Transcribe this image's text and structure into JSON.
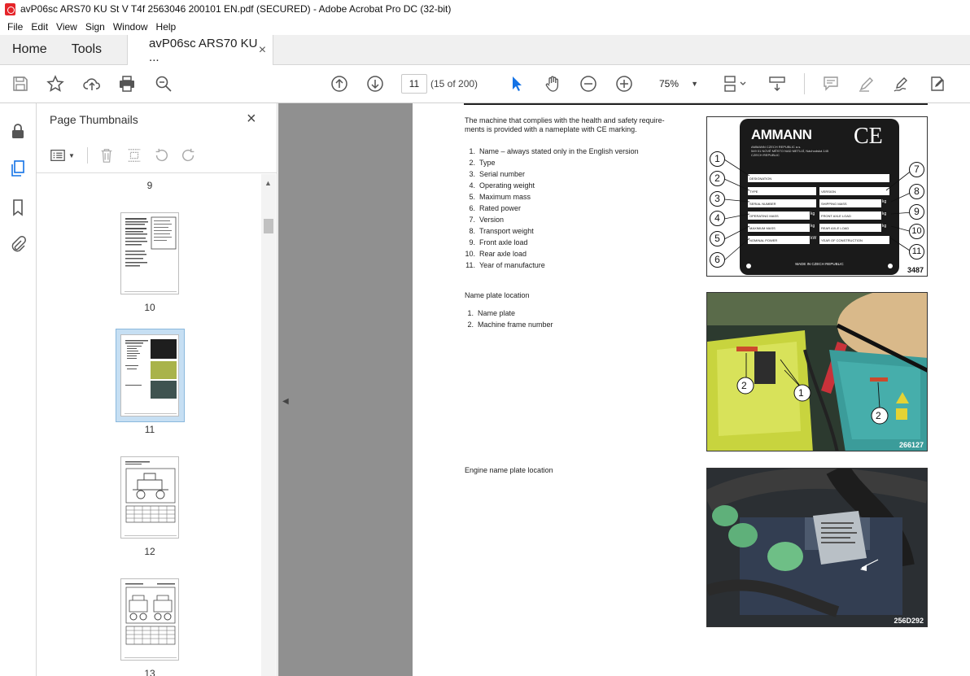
{
  "window": {
    "title": "avP06sc ARS70 KU St V T4f 2563046 200101 EN.pdf (SECURED) - Adobe Acrobat Pro DC (32-bit)"
  },
  "menu": [
    "File",
    "Edit",
    "View",
    "Sign",
    "Window",
    "Help"
  ],
  "tabs": {
    "home": "Home",
    "tools": "Tools",
    "document": "avP06sc ARS70 KU ...",
    "close": "×"
  },
  "toolbar": {
    "page_number": "11",
    "page_of": "(15 of 200)",
    "zoom": "75%"
  },
  "thumbnails": {
    "title": "Page Thumbnails",
    "pages": [
      {
        "label": "9"
      },
      {
        "label": "10"
      },
      {
        "label": "11",
        "selected": true
      },
      {
        "label": "12"
      },
      {
        "label": "13"
      }
    ]
  },
  "document": {
    "intro": "The machine that complies with the health and safety requirements is provided with a nameplate with CE marking.",
    "intro_line1": "The machine that complies with the health and safety require-",
    "intro_line2": "ments is provided with a nameplate with CE marking.",
    "nameplate_items": [
      "Name – always stated only in the English version",
      "Type",
      "Serial number",
      "Operating weight",
      "Maximum mass",
      "Rated power",
      "Version",
      "Transport weight",
      "Front axle load",
      "Rear axle load",
      "Year of manufacture"
    ],
    "location_heading": "Name plate location",
    "location_items": [
      "Name plate",
      "Machine frame number"
    ],
    "engine_heading": "Engine name plate location",
    "figures": {
      "plate_code": "3487",
      "photo1_code": "266127",
      "photo2_code": "256D292"
    },
    "plate": {
      "brand": "AMMANN",
      "ce": "CE",
      "company": "AMMANN CZECH REPUBLIC a.s.",
      "address": "549 01 NOVÉ MĚSTO NAD METUJÍ, Náchodská 145",
      "country": "CZECH REPUBLIC",
      "fields": [
        "DESIGNATION",
        "TYPE",
        "VERSION",
        "SERIAL NUMBER",
        "SHIPPING MASS",
        "OPERATING MASS",
        "FRONT AXLE LOAD",
        "MAXIMUM MASS",
        "REAR AXLE LOAD",
        "NOMINAL POWER",
        "YEAR OF CONSTRUCTION"
      ],
      "unit_kg": "kg",
      "unit_kw": "kW",
      "footer": "MADE IN CZECH REPUBLIC"
    },
    "callouts": [
      "1",
      "2",
      "3",
      "4",
      "5",
      "6",
      "7",
      "8",
      "9",
      "10",
      "11"
    ]
  },
  "colors": {
    "accent": "#1473e6",
    "selection": "#c6dff3",
    "doc_bg": "#909090"
  }
}
